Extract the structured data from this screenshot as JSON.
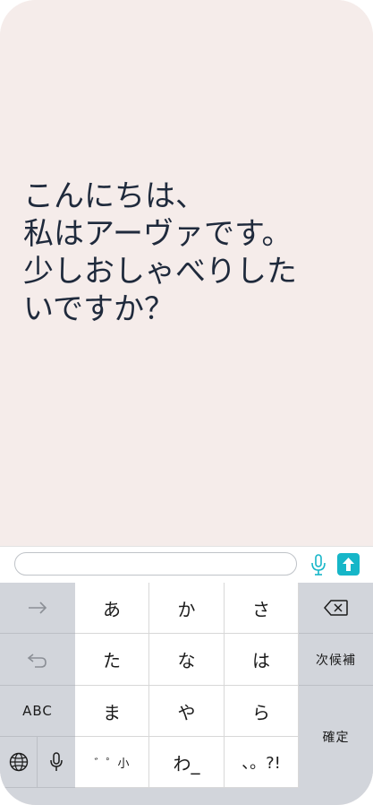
{
  "chat": {
    "message_lines": [
      "こんにちは、",
      "私はアーヴァです。",
      "少しおしゃべりした",
      "いですか？"
    ]
  },
  "composer": {
    "input_value": "",
    "input_placeholder": "",
    "mic_icon": "microphone-icon",
    "send_icon": "send-arrow-icon",
    "accent_color": "#16b6c8"
  },
  "keyboard": {
    "row1": [
      "あ",
      "か",
      "さ"
    ],
    "row2": [
      "た",
      "な",
      "は"
    ],
    "row3": [
      "ま",
      "や",
      "ら"
    ],
    "row4": [
      "゛゜小",
      "わ_",
      "、。?!"
    ],
    "left_abc": "ABC",
    "right_next": "次候補",
    "right_confirm": "確定",
    "icons": {
      "arrow": "right-arrow-icon",
      "undo": "undo-icon",
      "globe": "globe-icon",
      "mic": "microphone-icon",
      "backspace": "backspace-icon"
    }
  }
}
